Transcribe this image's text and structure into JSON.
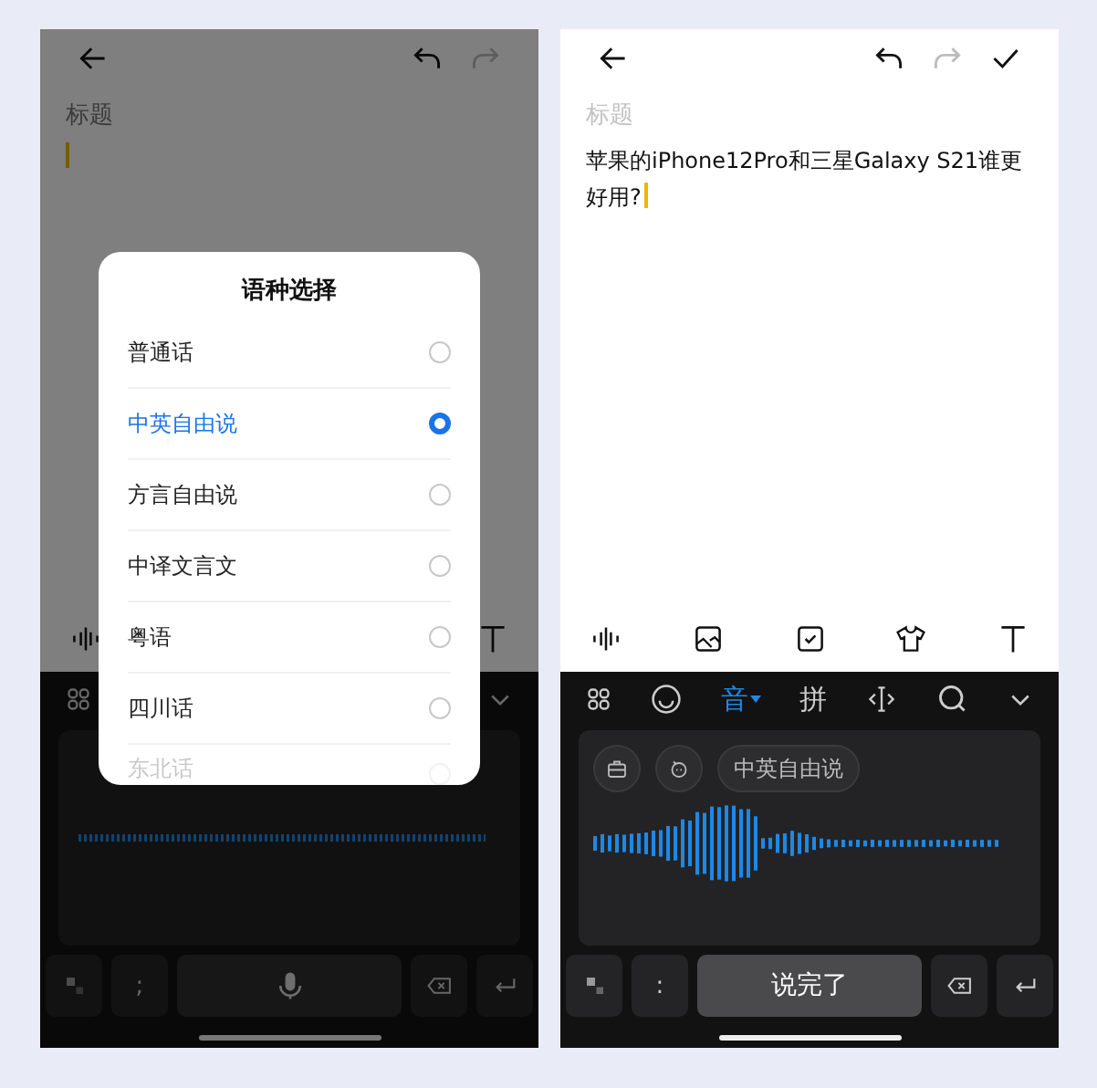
{
  "left": {
    "title_placeholder": "标题",
    "redo_disabled": true,
    "punct_key": ";",
    "dialog": {
      "title": "语种选择",
      "options": [
        {
          "label": "普通话",
          "selected": false
        },
        {
          "label": "中英自由说",
          "selected": true
        },
        {
          "label": "方言自由说",
          "selected": false
        },
        {
          "label": "中译文言文",
          "selected": false
        },
        {
          "label": "粤语",
          "selected": false
        },
        {
          "label": "四川话",
          "selected": false
        },
        {
          "label": "东北话",
          "selected": false
        }
      ]
    }
  },
  "right": {
    "title_placeholder": "标题",
    "body": "苹果的iPhone12Pro和三星Galaxy S21谁更好用?",
    "redo_disabled": true,
    "tabs": [
      {
        "label": "音",
        "selected": true
      },
      {
        "label": "拼",
        "selected": false
      }
    ],
    "language_chip": "中英自由说",
    "punct_key": ":",
    "done_key": "说完了"
  }
}
